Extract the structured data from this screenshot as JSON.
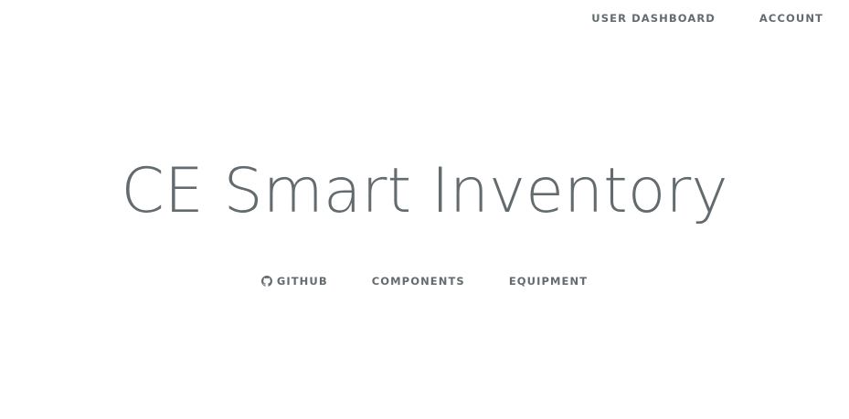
{
  "top_nav": {
    "user_dashboard": "USER DASHBOARD",
    "account": "ACCOUNT"
  },
  "title": "CE Smart Inventory",
  "links": {
    "github": {
      "label": "GITHUB",
      "icon": "github-icon"
    },
    "components": {
      "label": "COMPONENTS"
    },
    "equipment": {
      "label": "EQUIPMENT"
    }
  },
  "colors": {
    "text": "#636b6f",
    "background": "#ffffff"
  }
}
